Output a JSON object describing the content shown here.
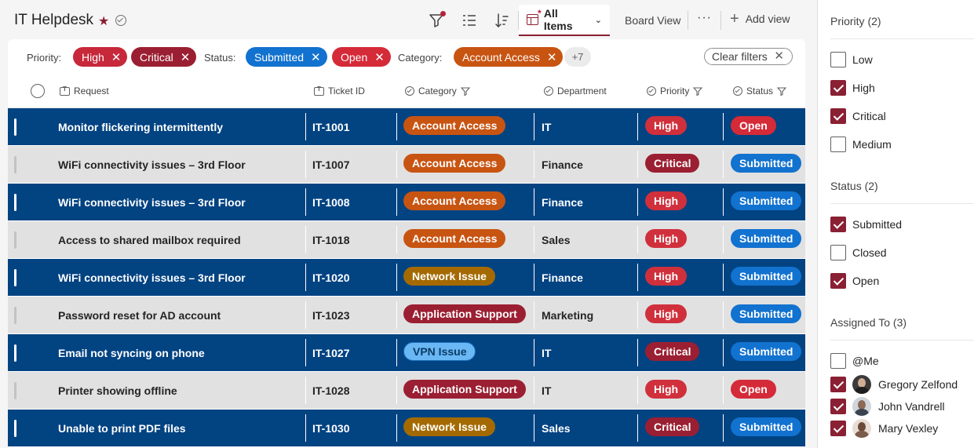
{
  "header": {
    "title": "IT Helpdesk",
    "tabs": {
      "all_items": "All Items",
      "board_view": "Board View"
    },
    "more": "···",
    "add_view": "Add view"
  },
  "filterbar": {
    "priority_label": "Priority:",
    "status_label": "Status:",
    "category_label": "Category:",
    "priority_chips": [
      {
        "label": "High",
        "color": "#c7283a"
      },
      {
        "label": "Critical",
        "color": "#9b1f32"
      }
    ],
    "status_chips": [
      {
        "label": "Submitted",
        "color": "#1272cf"
      },
      {
        "label": "Open",
        "color": "#d52a38"
      }
    ],
    "category_chips": [
      {
        "label": "Account Access",
        "color": "#c85412"
      }
    ],
    "more_count": "+7",
    "clear": "Clear filters"
  },
  "columns": {
    "request": "Request",
    "ticket_id": "Ticket ID",
    "category": "Category",
    "department": "Department",
    "priority": "Priority",
    "status": "Status"
  },
  "colors": {
    "row_dark": "#024382",
    "row_light": "#e1e1e1",
    "accent": "#8a2033",
    "cat_account": "#c85412",
    "cat_network": "#a46a00",
    "cat_app": "#9b1f32",
    "cat_vpn": "#69b7f4",
    "pri_high": "#d0303c",
    "pri_critical": "#9b1f32",
    "stat_submitted": "#1272cf",
    "stat_open": "#d52a38"
  },
  "rows": [
    {
      "request": "Monitor flickering intermittently",
      "id": "IT-1001",
      "category": "Account Access",
      "department": "IT",
      "priority": "High",
      "status": "Open"
    },
    {
      "request": "WiFi connectivity issues – 3rd Floor",
      "id": "IT-1007",
      "category": "Account Access",
      "department": "Finance",
      "priority": "Critical",
      "status": "Submitted"
    },
    {
      "request": "WiFi connectivity issues – 3rd Floor",
      "id": "IT-1008",
      "category": "Account Access",
      "department": "Finance",
      "priority": "High",
      "status": "Submitted"
    },
    {
      "request": "Access to shared mailbox required",
      "id": "IT-1018",
      "category": "Account Access",
      "department": "Sales",
      "priority": "High",
      "status": "Submitted"
    },
    {
      "request": "WiFi connectivity issues – 3rd Floor",
      "id": "IT-1020",
      "category": "Network Issue",
      "department": "Finance",
      "priority": "High",
      "status": "Submitted"
    },
    {
      "request": "Password reset for AD account",
      "id": "IT-1023",
      "category": "Application Support",
      "department": "Marketing",
      "priority": "High",
      "status": "Submitted"
    },
    {
      "request": "Email not syncing on phone",
      "id": "IT-1027",
      "category": "VPN Issue",
      "department": "IT",
      "priority": "Critical",
      "status": "Submitted"
    },
    {
      "request": "Printer showing offline",
      "id": "IT-1028",
      "category": "Application Support",
      "department": "IT",
      "priority": "High",
      "status": "Open"
    },
    {
      "request": "Unable to print PDF files",
      "id": "IT-1030",
      "category": "Network Issue",
      "department": "Sales",
      "priority": "Critical",
      "status": "Submitted"
    }
  ],
  "pane": {
    "priority": {
      "title": "Priority (2)",
      "options": [
        {
          "label": "Low",
          "checked": false
        },
        {
          "label": "High",
          "checked": true
        },
        {
          "label": "Critical",
          "checked": true
        },
        {
          "label": "Medium",
          "checked": false
        }
      ]
    },
    "status": {
      "title": "Status (2)",
      "options": [
        {
          "label": "Submitted",
          "checked": true
        },
        {
          "label": "Closed",
          "checked": false
        },
        {
          "label": "Open",
          "checked": true
        }
      ]
    },
    "assigned": {
      "title": "Assigned To (3)",
      "me": {
        "label": "@Me",
        "checked": false
      },
      "people": [
        {
          "label": "Gregory Zelfond",
          "checked": true
        },
        {
          "label": "John Vandrell",
          "checked": true
        },
        {
          "label": "Mary Vexley",
          "checked": true
        }
      ]
    }
  }
}
